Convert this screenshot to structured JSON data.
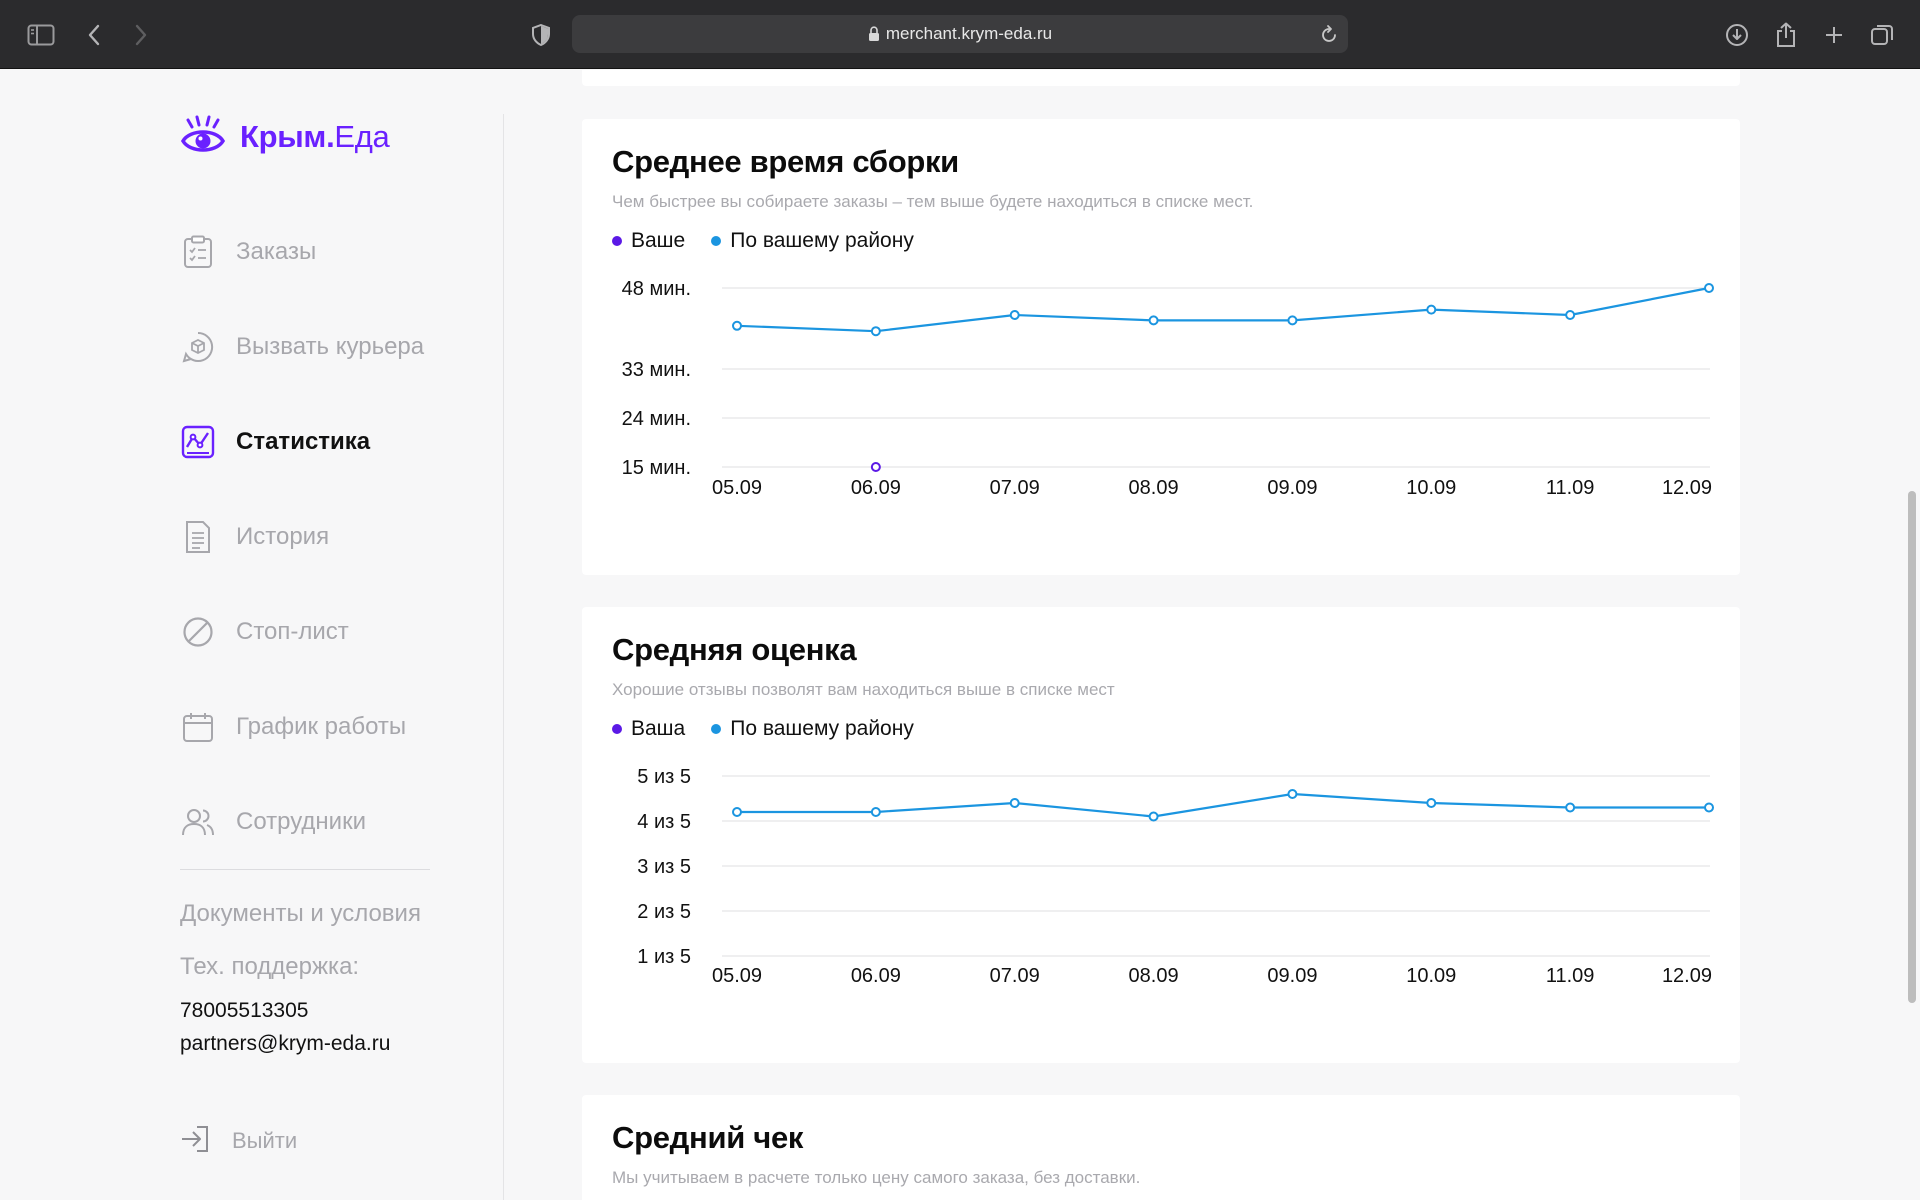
{
  "browser": {
    "url": "merchant.krym-eda.ru",
    "icons": [
      "sidebar-icon",
      "back-icon",
      "forward-icon",
      "shield-icon",
      "lock-icon",
      "reload-icon",
      "download-icon",
      "share-icon",
      "new-tab-icon",
      "tabs-icon"
    ]
  },
  "brand": {
    "name_part1": "Крым.",
    "name_part2": "Еда",
    "color": "#6a21ff"
  },
  "sidebar": {
    "items": [
      {
        "label": "Заказы",
        "icon": "clipboard-icon",
        "active": false
      },
      {
        "label": "Вызвать курьера",
        "icon": "courier-icon",
        "active": false
      },
      {
        "label": "Статистика",
        "icon": "statistics-icon",
        "active": true
      },
      {
        "label": "История",
        "icon": "document-icon",
        "active": false
      },
      {
        "label": "Стоп-лист",
        "icon": "stop-icon",
        "active": false
      },
      {
        "label": "График работы",
        "icon": "calendar-icon",
        "active": false
      },
      {
        "label": "Сотрудники",
        "icon": "users-icon",
        "active": false
      }
    ],
    "docs_label": "Документы и условия",
    "support_label": "Тех. поддержка:",
    "support_phone": "78005513305",
    "support_email": "partners@krym-eda.ru",
    "logout_label": "Выйти"
  },
  "colors": {
    "yours": "#5b19e6",
    "district": "#1b95e0"
  },
  "cards": [
    {
      "title": "Среднее время сборки",
      "subtitle": "Чем быстрее вы собираете заказы – тем выше будете находиться в списке мест.",
      "legend_yours": "Ваше",
      "legend_district": "По вашему району"
    },
    {
      "title": "Средняя оценка",
      "subtitle": "Хорошие отзывы позволят вам находиться выше в списке мест",
      "legend_yours": "Ваша",
      "legend_district": "По вашему району"
    },
    {
      "title": "Средний чек",
      "subtitle": "Мы учитываем в расчете только цену самого заказа, без доставки."
    }
  ],
  "chart_data": [
    {
      "type": "line",
      "categories": [
        "05.09",
        "06.09",
        "07.09",
        "08.09",
        "09.09",
        "10.09",
        "11.09",
        "12.09"
      ],
      "y_ticks": [
        {
          "label": "48 мин.",
          "value": 48
        },
        {
          "label": "33 мин.",
          "value": 33
        },
        {
          "label": "24 мин.",
          "value": 24
        },
        {
          "label": "15 мин.",
          "value": 15
        }
      ],
      "ylim": [
        15,
        48
      ],
      "grid": true,
      "legend": "top-left",
      "series": [
        {
          "name": "Ваше",
          "values": [
            null,
            15,
            null,
            null,
            null,
            null,
            null,
            null
          ]
        },
        {
          "name": "По вашему району",
          "values": [
            41,
            40,
            43,
            42,
            42,
            44,
            43,
            48
          ]
        }
      ]
    },
    {
      "type": "line",
      "categories": [
        "05.09",
        "06.09",
        "07.09",
        "08.09",
        "09.09",
        "10.09",
        "11.09",
        "12.09"
      ],
      "y_ticks": [
        {
          "label": "5 из 5",
          "value": 5
        },
        {
          "label": "4 из 5",
          "value": 4
        },
        {
          "label": "3 из 5",
          "value": 3
        },
        {
          "label": "2 из 5",
          "value": 2
        },
        {
          "label": "1 из 5",
          "value": 1
        }
      ],
      "ylim": [
        1,
        5
      ],
      "grid": true,
      "legend": "top-left",
      "series": [
        {
          "name": "Ваша",
          "values": [
            null,
            null,
            null,
            null,
            null,
            null,
            null,
            null
          ]
        },
        {
          "name": "По вашему району",
          "values": [
            4.2,
            4.2,
            4.4,
            4.1,
            4.6,
            4.4,
            4.3,
            4.3
          ]
        }
      ]
    }
  ]
}
